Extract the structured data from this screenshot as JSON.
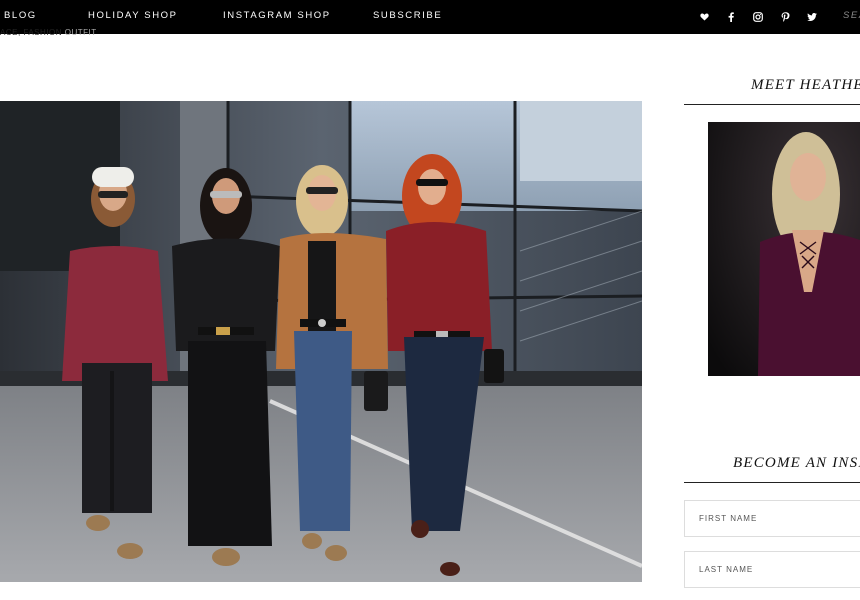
{
  "nav": {
    "links": [
      "BLOG",
      "HOLIDAY SHOP",
      "INSTAGRAM SHOP",
      "SUBSCRIBE"
    ],
    "search_label": "SEA",
    "social_icons": [
      "heart-icon",
      "facebook-icon",
      "instagram-icon",
      "pinterest-icon",
      "twitter-icon"
    ]
  },
  "breadcrumb": {
    "section": "ACE, FASHION",
    "current": "OUTFIT"
  },
  "hero": {
    "description": "Four women walking outdoors in holiday outfits"
  },
  "sidebar": {
    "about_title": "MEET HEATHE",
    "newsletter_title": "BECOME AN INSI",
    "first_name_placeholder": "FIRST NAME",
    "last_name_placeholder": "LAST NAME"
  },
  "colors": {
    "nav_bg": "#000000",
    "nav_text": "#ffffff",
    "rule": "#222222",
    "field_border": "#dddddd"
  }
}
